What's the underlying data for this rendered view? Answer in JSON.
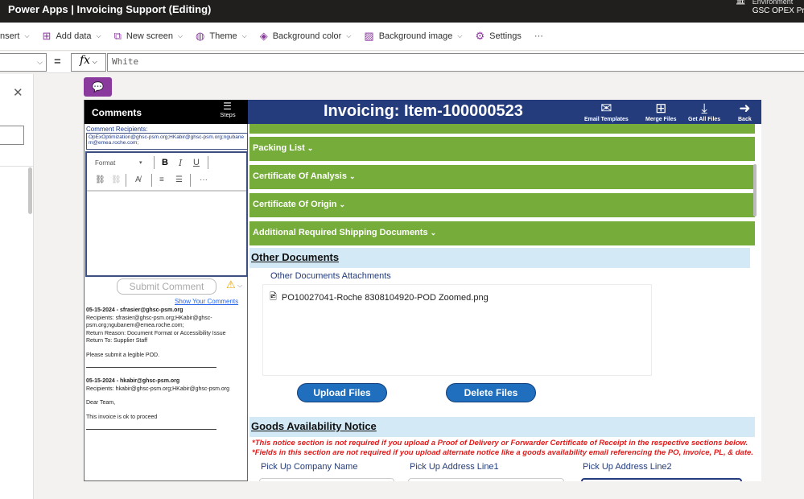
{
  "app": {
    "name": "Power Apps",
    "separator": "|",
    "doc_title": "Invoicing Support (Editing)"
  },
  "environment": {
    "label": "Environment",
    "value": "GSC OPEX Pr"
  },
  "commandbar": {
    "insert": "nsert",
    "add_data": "Add data",
    "new_screen": "New screen",
    "theme": "Theme",
    "background_color": "Background color",
    "background_image": "Background image",
    "settings": "Settings",
    "more": "···"
  },
  "formula": {
    "eq": "=",
    "fx": "fx",
    "value": "White"
  },
  "comments": {
    "title": "Comments",
    "steps": "Steps",
    "recipients_label": "Comment Recipients:",
    "recipients_value": "OpExOptimization@ghsc-psm.org;HKabir@ghsc-psm.org;ngubanem@emea.roche.com;",
    "format": "Format",
    "submit": "Submit Comment",
    "show_comments": "Show Your Comments",
    "entries": [
      {
        "header": "05-15-2024 - sfrasier@ghsc-psm.org",
        "recipients": "Recipients: sfrasier@ghsc-psm.org;HKabir@ghsc-psm.org;ngubanem@emea.roche.com;",
        "reason": "Return Reason: Document Format or Accessibility Issue",
        "return_to": "Return To: Supplier Staff",
        "body": "Please submit a legible POD."
      },
      {
        "header": "05-15-2024 - hkabir@ghsc-psm.org",
        "recipients": "Recipients: hkabir@ghsc-psm.org;HKabir@ghsc-psm.org",
        "greeting": "Dear Team,",
        "body": "This invoice is ok to proceed"
      }
    ]
  },
  "main": {
    "title": "Invoicing: Item-100000523",
    "buttons": {
      "email": "Email Templates",
      "merge": "Merge Files",
      "getall": "Get All Files",
      "back": "Back"
    },
    "sections": [
      "Packing List",
      "Certificate Of Analysis",
      "Certificate Of Origin",
      "Additional Required Shipping Documents"
    ],
    "other_docs": {
      "title": "Other Documents",
      "attach_label": "Other Documents Attachments",
      "file": "PO10027041-Roche 8308104920-POD Zoomed.png",
      "upload": "Upload Files",
      "delete": "Delete Files"
    },
    "goods": {
      "title": "Goods Availability Notice",
      "note1": "*This notice section is not required if you upload a Proof of Delivery or Forwarder Certificate of Receipt in the respective sections below.",
      "note2": "*Fields in this section are not required if you upload alternate notice like a goods availability email referencing the PO, invoice, PL, & date.",
      "fields": [
        "Pick Up Company Name",
        "Pick Up Address Line1",
        "Pick Up Address Line2"
      ]
    }
  },
  "colors": {
    "accent": "#8a3a9d",
    "header": "#243c7c",
    "green": "#76ad3a",
    "button": "#1f6fbe"
  }
}
